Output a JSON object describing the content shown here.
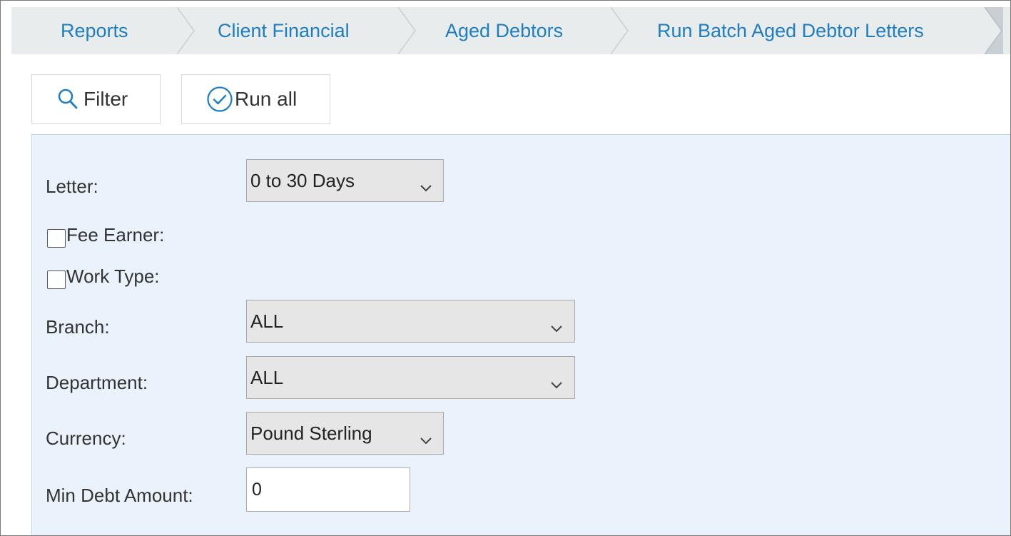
{
  "breadcrumb": {
    "items": [
      {
        "label": "Reports"
      },
      {
        "label": "Client Financial"
      },
      {
        "label": "Aged Debtors"
      },
      {
        "label": "Run Batch Aged Debtor Letters"
      }
    ]
  },
  "toolbar": {
    "filter_label": "Filter",
    "run_all_label": "Run all"
  },
  "form": {
    "letter": {
      "label": "Letter:",
      "value": "0 to 30 Days"
    },
    "fee_earner": {
      "label": "Fee Earner:",
      "checked": false
    },
    "work_type": {
      "label": "Work Type:",
      "checked": false
    },
    "branch": {
      "label": "Branch:",
      "value": "ALL"
    },
    "department": {
      "label": "Department:",
      "value": "ALL"
    },
    "currency": {
      "label": "Currency:",
      "value": "Pound Sterling"
    },
    "min_debt": {
      "label": "Min Debt Amount:",
      "value": "0"
    }
  },
  "colors": {
    "accent": "#1f7dc1",
    "panel_bg": "#eaf3fb",
    "breadcrumb_bg": "#e8eced"
  }
}
